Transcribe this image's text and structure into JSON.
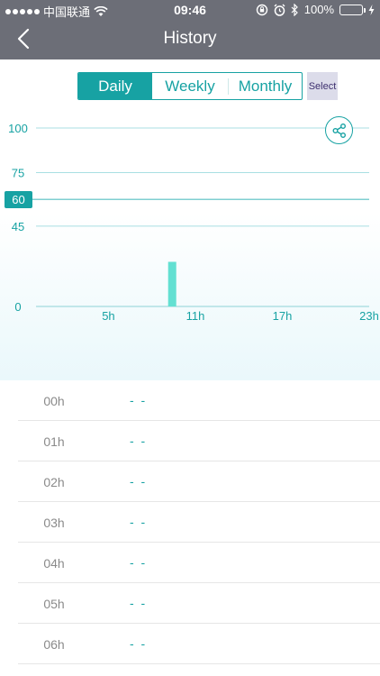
{
  "status_bar": {
    "carrier": "中国联通",
    "time": "09:46",
    "battery": "100%"
  },
  "nav": {
    "title": "History"
  },
  "tabs": [
    {
      "label": "Daily",
      "active": true
    },
    {
      "label": "Weekly",
      "active": false
    },
    {
      "label": "Monthly",
      "active": false
    }
  ],
  "select_label": "Select",
  "colors": {
    "accent": "#17a2a3",
    "bar": "#63e0d2",
    "header": "#6c6e77"
  },
  "chart_data": {
    "type": "bar",
    "y_ticks": [
      0,
      45,
      75,
      100
    ],
    "ylim": [
      0,
      100
    ],
    "reference_line": {
      "value": 60,
      "label": "60"
    },
    "x_ticks": [
      "5h",
      "11h",
      "17h",
      "23h"
    ],
    "xlim": [
      0,
      23
    ],
    "bars": [
      {
        "x": 9,
        "value": 25
      }
    ]
  },
  "list": [
    {
      "hour": "00h",
      "value": "- -"
    },
    {
      "hour": "01h",
      "value": "- -"
    },
    {
      "hour": "02h",
      "value": "- -"
    },
    {
      "hour": "03h",
      "value": "- -"
    },
    {
      "hour": "04h",
      "value": "- -"
    },
    {
      "hour": "05h",
      "value": "- -"
    },
    {
      "hour": "06h",
      "value": "- -"
    }
  ]
}
